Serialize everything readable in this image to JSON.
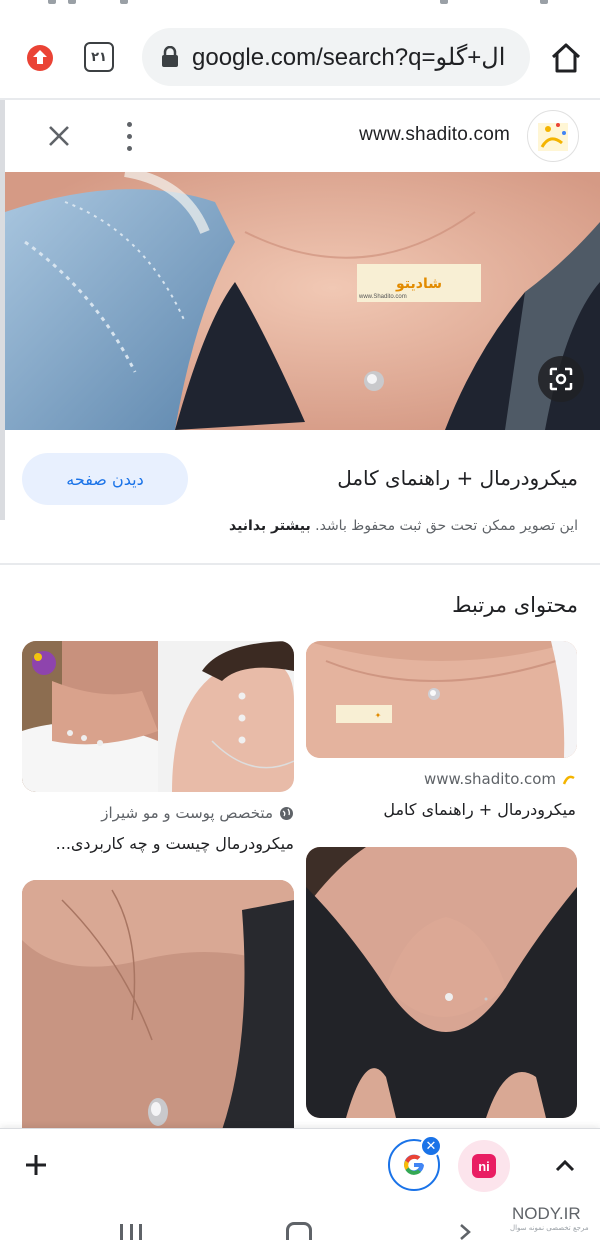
{
  "browser": {
    "tab_count": "۲۱",
    "url": "google.com/search?q=ال+گلو"
  },
  "viewer": {
    "site_name": "www.shadito.com",
    "photo_watermark": "شادیتو",
    "photo_watermark_url": "www.Shadito.com",
    "visit_button": "دیدن صفحه",
    "title": "میکرودرمال + راهنمای کامل",
    "copyright_text": "این تصویر ممکن تحت حق ثبت محفوظ باشد.",
    "copyright_link": "بیشتر بدانید"
  },
  "related": {
    "heading": "محتوای مرتبط",
    "cards": [
      {
        "source": "www.shadito.com",
        "title": "میکرودرمال + راهنمای کامل"
      },
      {
        "source": "متخصص پوست و مو شیراز",
        "title": "میکرودرمال چیست و چه کاربردی..."
      }
    ]
  },
  "watermark": {
    "site": "NODY.IR",
    "tagline": "مرجع تخصصی نمونه سوال"
  },
  "colors": {
    "accent": "#1a73e8",
    "visit_button_bg": "#e8f0fe",
    "danger": "#ea4335"
  },
  "icons": [
    "home-icon",
    "tabs-icon",
    "lock-icon",
    "close-icon",
    "more-vert-icon",
    "lens-icon",
    "plus-icon",
    "google-icon",
    "chevron-up-icon",
    "globe-icon"
  ]
}
